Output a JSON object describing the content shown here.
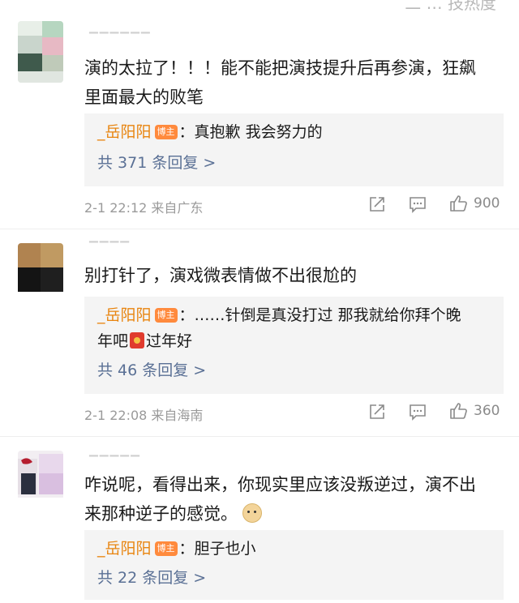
{
  "top_cut_text": "二 … 技热度",
  "comments": [
    {
      "text": "演的太拉了！！！能不能把演技提升后再参演，狂飙里面最大的败笔",
      "reply": {
        "name": "_岳阳阳",
        "badge": "博主",
        "sep": "：",
        "text": "真抱歉 我会努力的",
        "more": "共 371 条回复 >"
      },
      "time": "2-1 22:12 来自广东",
      "likes": "900"
    },
    {
      "text": "别打针了，演戏微表情做不出很尬的",
      "reply": {
        "name": "_岳阳阳",
        "badge": "博主",
        "sep": "：",
        "text": "……针倒是真没打过 那我就给你拜个晚",
        "text2": "年吧",
        "text3": "过年好",
        "more": "共 46 条回复 >"
      },
      "time": "2-1 22:08 来自海南",
      "likes": "360"
    },
    {
      "text": "咋说呢，看得出来，你现实里应该没叛逆过，演不出来那种逆子的感觉。",
      "reply": {
        "name": "_岳阳阳",
        "badge": "博主",
        "sep": "：",
        "text": "胆子也小",
        "more": "共 22 条回复 >"
      }
    }
  ],
  "icons": {
    "share": "share-icon",
    "comment": "comment-icon",
    "like": "thumbs-up-icon",
    "red_packet": "red-packet-emoji",
    "doge": "doge-emoji"
  },
  "colors": {
    "name": "#e8840e",
    "badge": "#ff8a3d",
    "link": "#5a7095",
    "meta": "#9a9a9a",
    "reply_bg": "#f4f4f4"
  }
}
